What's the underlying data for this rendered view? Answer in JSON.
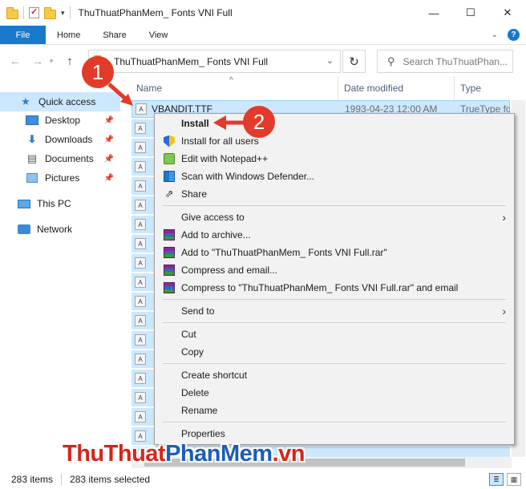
{
  "window": {
    "title": "ThuThuatPhanMem_ Fonts VNI Full",
    "minimize": "—",
    "maximize": "☐",
    "close": "✕"
  },
  "ribbon": {
    "tabs": [
      "File",
      "Home",
      "Share",
      "View"
    ],
    "accent": "#1979ca"
  },
  "address": {
    "path": "ThuThuatPhanMem_ Fonts VNI Full",
    "search_placeholder": "Search ThuThuatPhan..."
  },
  "sidebar": {
    "items": [
      {
        "label": "Quick access",
        "icon": "star-icon"
      },
      {
        "label": "Desktop",
        "icon": "desktop-icon"
      },
      {
        "label": "Downloads",
        "icon": "download-icon"
      },
      {
        "label": "Documents",
        "icon": "documents-icon"
      },
      {
        "label": "Pictures",
        "icon": "pictures-icon"
      },
      {
        "label": "This PC",
        "icon": "pc-icon"
      },
      {
        "label": "Network",
        "icon": "network-icon"
      }
    ]
  },
  "filelist": {
    "columns": [
      "Name",
      "Date modified",
      "Type"
    ],
    "first_row": {
      "name": "VBANDIT.TTF",
      "date": "1993-04-23 12:00 AM",
      "type": "TrueType for"
    },
    "selection_color": "#cce8ff"
  },
  "context_menu": {
    "items": [
      {
        "label": "Install",
        "icon": "none"
      },
      {
        "label": "Install for all users",
        "icon": "uac-shield-icon"
      },
      {
        "label": "Edit with Notepad++",
        "icon": "notepadpp-icon"
      },
      {
        "label": "Scan with Windows Defender...",
        "icon": "defender-icon"
      },
      {
        "label": "Share",
        "icon": "share-icon"
      },
      {
        "label": "Give access to",
        "icon": "none"
      },
      {
        "label": "Add to archive...",
        "icon": "winrar-icon"
      },
      {
        "label": "Add to \"ThuThuatPhanMem_ Fonts VNI Full.rar\"",
        "icon": "winrar-icon"
      },
      {
        "label": "Compress and email...",
        "icon": "winrar-icon"
      },
      {
        "label": "Compress to \"ThuThuatPhanMem_ Fonts VNI Full.rar\" and email",
        "icon": "winrar-icon"
      },
      {
        "label": "Send to",
        "icon": "none"
      },
      {
        "label": "Cut",
        "icon": "none"
      },
      {
        "label": "Copy",
        "icon": "none"
      },
      {
        "label": "Create shortcut",
        "icon": "none"
      },
      {
        "label": "Delete",
        "icon": "none"
      },
      {
        "label": "Rename",
        "icon": "none"
      },
      {
        "label": "Properties",
        "icon": "none"
      }
    ]
  },
  "status": {
    "count": "283 items",
    "selected": "283 items selected"
  },
  "annotations": {
    "step1": "1",
    "step2": "2",
    "color": "#e23b2a"
  },
  "watermark": {
    "part1": "ThuThuat",
    "part2": "PhanMem",
    "part3": ".vn"
  }
}
